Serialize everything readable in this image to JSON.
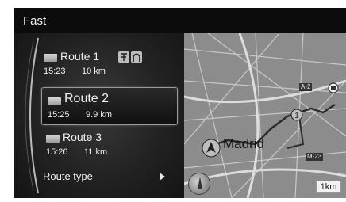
{
  "title_bar": {
    "title": "Fast"
  },
  "routes": [
    {
      "name": "Route 1",
      "time": "15:23",
      "distance": "10 km",
      "selected": false
    },
    {
      "name": "Route 2",
      "time": "15:25",
      "distance": "9.9 km",
      "selected": true
    },
    {
      "name": "Route 3",
      "time": "15:26",
      "distance": "11 km",
      "selected": false
    }
  ],
  "route_type": {
    "label": "Route type"
  },
  "route1_icons": [
    "toll-road-icon",
    "tunnel-icon"
  ],
  "map": {
    "city_label": "Madrid",
    "road_labels": [
      "A-2",
      "M-23"
    ],
    "scale": "1km"
  },
  "colors": {
    "background": "#1a1a1a",
    "title_bar": "#0c0c0c",
    "map": "#8c8c8c",
    "route_line": "#333333"
  }
}
